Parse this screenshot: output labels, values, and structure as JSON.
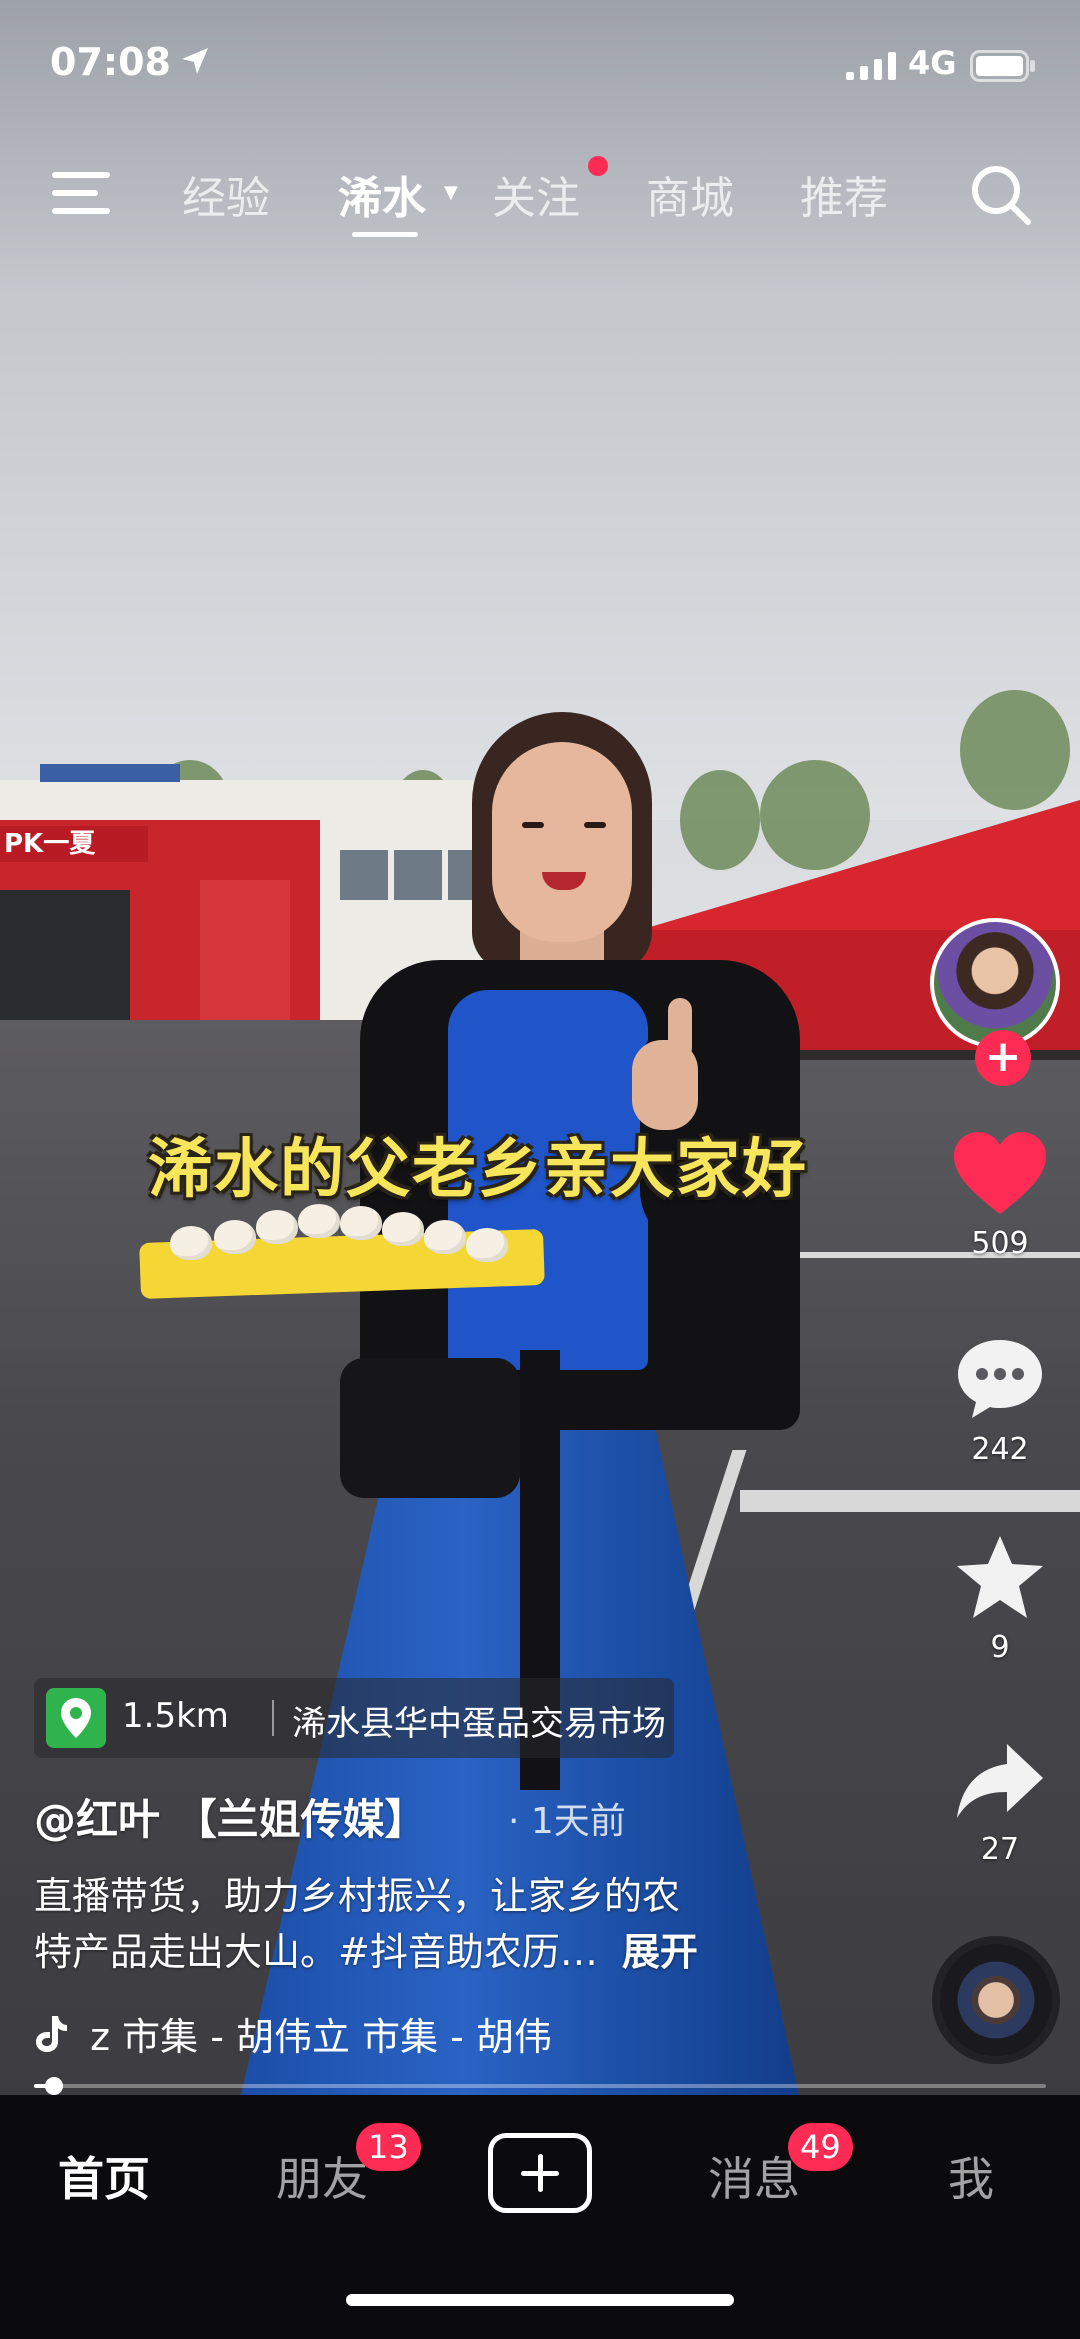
{
  "status_bar": {
    "time": "07:08",
    "network": "4G"
  },
  "top_nav": {
    "tabs": [
      {
        "label": "经验"
      },
      {
        "label": "浠水"
      },
      {
        "label": "关注"
      },
      {
        "label": "商城"
      },
      {
        "label": "推荐"
      }
    ],
    "active_tab": "浠水"
  },
  "video": {
    "caption": "浠水的父老乡亲大家好",
    "sign_text": "PK一夏"
  },
  "actions": {
    "likes": "509",
    "comments": "242",
    "favorites": "9",
    "shares": "27"
  },
  "post": {
    "location_distance": "1.5km",
    "location_name": "浠水县华中蛋品交易市场",
    "author": "@红叶  【兰姐传媒】",
    "time": "· 1天前",
    "description_line1": "直播带货，助力乡村振兴，让家乡的农",
    "description_line2": "特产品走出大山。#抖音助农历…",
    "expand_label": "展开",
    "music": "z    市集 - 胡伟立    市集 - 胡伟",
    "progress": 0.02
  },
  "tabbar": {
    "items": [
      {
        "label": "首页"
      },
      {
        "label": "朋友",
        "badge": "13"
      },
      {
        "label": "消息",
        "badge": "49"
      },
      {
        "label": "我"
      }
    ]
  },
  "colors": {
    "accent": "#fe2c55",
    "caption": "#f7e55c",
    "location_pin": "#2fb34c"
  }
}
